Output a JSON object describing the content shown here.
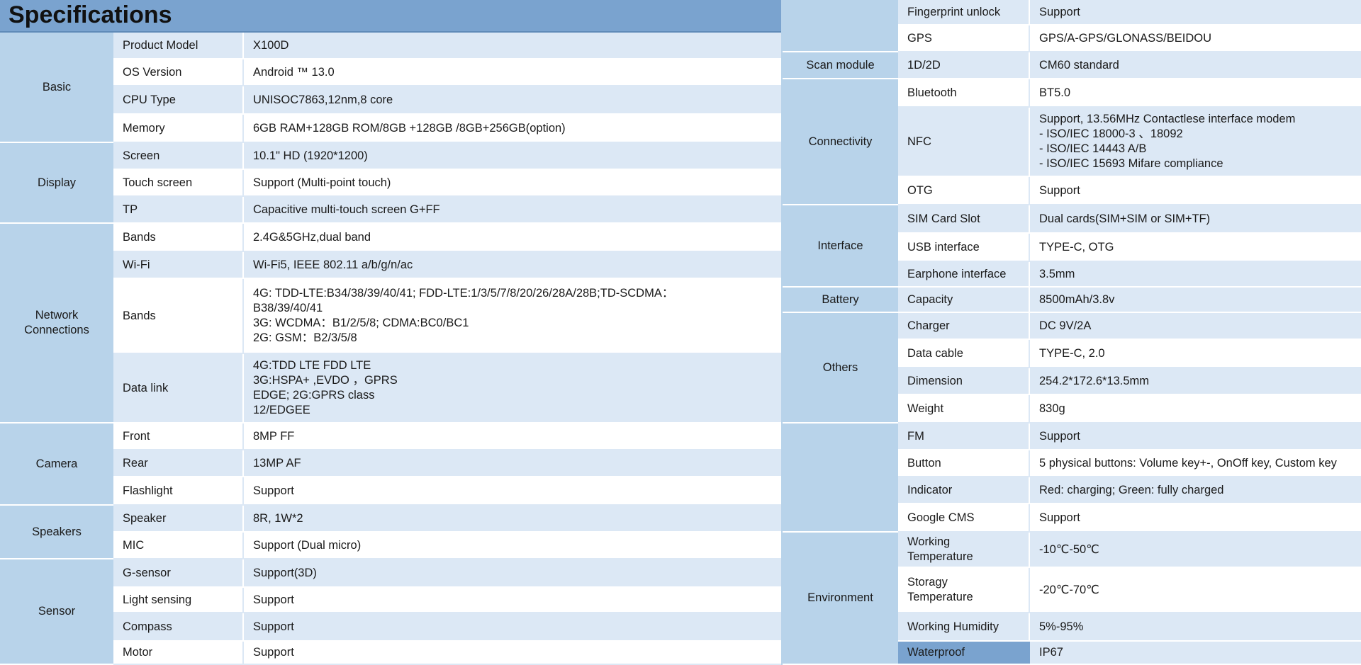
{
  "title": "Specifications",
  "left": [
    {
      "category": "Basic",
      "rows": [
        {
          "label": "Product Model",
          "value": "X100D"
        },
        {
          "label": "OS Version",
          "value": "Android ™ 13.0"
        },
        {
          "label": "CPU Type",
          "value": "UNISOC7863,12nm,8 core"
        },
        {
          "label": "Memory",
          "value": "6GB RAM+128GB ROM/8GB +128GB /8GB+256GB(option)"
        }
      ]
    },
    {
      "category": "Display",
      "rows": [
        {
          "label": "Screen",
          "value": "10.1\" HD (1920*1200)"
        },
        {
          "label": "Touch screen",
          "value": "Support (Multi-point touch)"
        },
        {
          "label": "TP",
          "value": "Capacitive multi-touch screen G+FF"
        }
      ]
    },
    {
      "category": "Network\nConnections",
      "rows": [
        {
          "label": "Bands",
          "value": "2.4G&5GHz,dual band"
        },
        {
          "label": "Wi-Fi",
          "value": "Wi-Fi5, IEEE 802.11 a/b/g/n/ac"
        },
        {
          "label": "Bands",
          "value": "4G: TDD-LTE:B34/38/39/40/41; FDD-LTE:1/3/5/7/8/20/26/28A/28B;TD-SCDMA：\nB38/39/40/41\n3G: WCDMA：B1/2/5/8; CDMA:BC0/BC1\n2G: GSM：B2/3/5/8"
        },
        {
          "label": "Data link",
          "value": "4G:TDD  LTE  FDD  LTE\n3G:HSPA+ ,EVDO ，GPRS\nEDGE; 2G:GPRS class\n12/EDGEE"
        }
      ]
    },
    {
      "category": "Camera",
      "rows": [
        {
          "label": "Front",
          "value": "8MP FF"
        },
        {
          "label": "Rear",
          "value": "13MP AF"
        },
        {
          "label": "Flashlight",
          "value": "Support"
        }
      ]
    },
    {
      "category": "Speakers",
      "rows": [
        {
          "label": "Speaker",
          "value": "8R, 1W*2"
        },
        {
          "label": "MIC",
          "value": "Support (Dual micro)"
        }
      ]
    },
    {
      "category": "Sensor",
      "rows": [
        {
          "label": "G-sensor",
          "value": "Support(3D)"
        },
        {
          "label": "Light sensing",
          "value": "Support"
        },
        {
          "label": "Compass",
          "value": "Support"
        },
        {
          "label": "Motor",
          "value": "Support"
        }
      ]
    }
  ],
  "right": [
    {
      "category": "",
      "rows": [
        {
          "label": "Fingerprint unlock",
          "value": "Support"
        },
        {
          "label": "GPS",
          "value": "GPS/A-GPS/GLONASS/BEIDOU"
        }
      ]
    },
    {
      "category": "Scan module",
      "rows": [
        {
          "label": "1D/2D",
          "value": "CM60 standard"
        }
      ]
    },
    {
      "category": "Connectivity",
      "rows": [
        {
          "label": "Bluetooth",
          "value": "BT5.0"
        },
        {
          "label": "NFC",
          "value": "Support, 13.56MHz Contactlese interface modem\n- ISO/IEC 18000-3 、18092\n- ISO/IEC 14443 A/B\n- ISO/IEC 15693 Mifare compliance"
        },
        {
          "label": "OTG",
          "value": "Support"
        }
      ]
    },
    {
      "category": "Interface",
      "rows": [
        {
          "label": "SIM Card Slot",
          "value": "Dual cards(SIM+SIM or SIM+TF)"
        },
        {
          "label": "USB interface",
          "value": "TYPE-C, OTG"
        },
        {
          "label": "Earphone interface",
          "value": "3.5mm"
        }
      ]
    },
    {
      "category": "Battery",
      "rows": [
        {
          "label": "Capacity",
          "value": "8500mAh/3.8v"
        }
      ]
    },
    {
      "category": "Others",
      "rows": [
        {
          "label": "Charger",
          "value": "DC 9V/2A"
        },
        {
          "label": "Data cable",
          "value": "TYPE-C, 2.0"
        },
        {
          "label": "Dimension",
          "value": "254.2*172.6*13.5mm"
        },
        {
          "label": "Weight",
          "value": "830g"
        }
      ]
    },
    {
      "category": "",
      "rows": [
        {
          "label": "FM",
          "value": "Support"
        },
        {
          "label": "Button",
          "value": "5 physical buttons: Volume key+-, OnOff key, Custom key"
        },
        {
          "label": "Indicator",
          "value": "Red: charging; Green: fully charged"
        },
        {
          "label": "Google CMS",
          "value": "Support"
        }
      ]
    },
    {
      "category": "Environment",
      "rows": [
        {
          "label": "Working\nTemperature",
          "value": "-10℃-50℃"
        },
        {
          "label": "Storagy\nTemperature",
          "value": "-20℃-70℃"
        },
        {
          "label": "Working Humidity",
          "value": "5%-95%"
        },
        {
          "label": "Waterproof",
          "value": "IP67"
        }
      ]
    }
  ]
}
